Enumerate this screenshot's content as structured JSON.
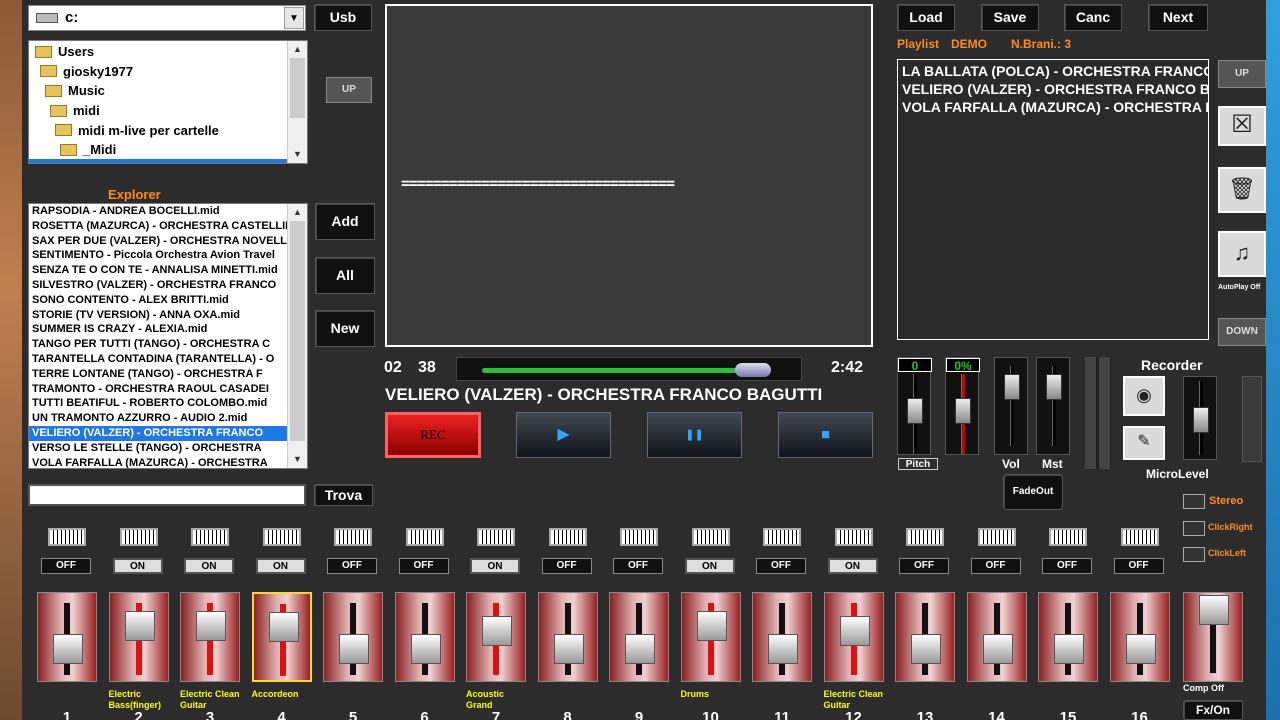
{
  "drive": {
    "label": "c:"
  },
  "buttons": {
    "usb": "Usb",
    "add": "Add",
    "all": "All",
    "new": "New",
    "find": "Trova",
    "up": "UP",
    "down": "DOWN"
  },
  "tree": [
    "Users",
    "giosky1977",
    "Music",
    "midi",
    "midi m-live per cartelle",
    "_Midi"
  ],
  "explorer_label": "Explorer",
  "files": [
    "RAPSODIA - ANDREA BOCELLI.mid",
    "ROSETTA (MAZURCA) - ORCHESTRA CASTELLINA",
    "SAX PER DUE (VALZER) - ORCHESTRA NOVELLO",
    "SENTIMENTO - Piccola Orchestra Avion Travel",
    "SENZA TE O CON TE - ANNALISA MINETTI.mid",
    "SILVESTRO (VALZER) - ORCHESTRA FRANCO",
    "SONO CONTENTO - ALEX BRITTI.mid",
    "STORIE (TV VERSION) - ANNA OXA.mid",
    "SUMMER IS CRAZY - ALEXIA.mid",
    "TANGO PER TUTTI (TANGO) - ORCHESTRA C",
    "TARANTELLA CONTADINA (TARANTELLA) - O",
    "TERRE LONTANE (TANGO) - ORCHESTRA F",
    "TRAMONTO - ORCHESTRA RAOUL CASADEI",
    "TUTTI BEATIFUL - ROBERTO COLOMBO.mid",
    "UN TRAMONTO AZZURRO - AUDIO 2.mid",
    "VELIERO (VALZER) - ORCHESTRA FRANCO",
    "VERSO LE STELLE (TANGO) - ORCHESTRA",
    "VOLA FARFALLA (MAZURCA) - ORCHESTRA"
  ],
  "selected_file_index": 15,
  "display": {
    "text": "=================================="
  },
  "player": {
    "minutes": "02",
    "seconds": "38",
    "total": "2:42",
    "progress": 0.97,
    "song": "VELIERO (VALZER) - ORCHESTRA FRANCO BAGUTTI",
    "rec": "REC",
    "play_icon": "▶",
    "pause_icon": "❚❚",
    "stop_icon": "■"
  },
  "top": {
    "load": "Load",
    "save": "Save",
    "canc": "Canc",
    "next": "Next"
  },
  "playlist": {
    "label": "Playlist",
    "name": "DEMO",
    "count_label": "N.Brani.: 3",
    "items": [
      "LA BALLATA (POLCA) - ORCHESTRA FRANCO",
      "VELIERO (VALZER) - ORCHESTRA FRANCO B",
      "VOLA FARFALLA (MAZURCA) - ORCHESTRA F"
    ]
  },
  "side": {
    "autoplay": "AutoPlay Off",
    "recorder": "Recorder",
    "microlevel": "MicroLevel",
    "fadeout": "FadeOut"
  },
  "meters": {
    "pitch_val": "0",
    "pitch_label": "Pitch",
    "pct_val": "0%",
    "vol": "Vol",
    "mst": "Mst"
  },
  "options": {
    "stereo": "Stereo",
    "clickright": "ClickRight",
    "clickleft": "ClickLeft"
  },
  "mixer": [
    {
      "num": "1",
      "state": "OFF",
      "name": "",
      "level": 0.35
    },
    {
      "num": "2",
      "state": "ON",
      "name": "Electric Bass(finger)",
      "level": 0.8
    },
    {
      "num": "3",
      "state": "ON",
      "name": "Electric Clean Guitar",
      "level": 0.8
    },
    {
      "num": "4",
      "state": "ON",
      "name": "Accordeon",
      "level": 0.8
    },
    {
      "num": "5",
      "state": "OFF",
      "name": "",
      "level": 0.35
    },
    {
      "num": "6",
      "state": "OFF",
      "name": "",
      "level": 0.35
    },
    {
      "num": "7",
      "state": "ON",
      "name": "Acoustic Grand",
      "level": 0.7
    },
    {
      "num": "8",
      "state": "OFF",
      "name": "",
      "level": 0.35
    },
    {
      "num": "9",
      "state": "OFF",
      "name": "",
      "level": 0.35
    },
    {
      "num": "10",
      "state": "ON",
      "name": "Drums",
      "level": 0.8
    },
    {
      "num": "11",
      "state": "OFF",
      "name": "",
      "level": 0.35
    },
    {
      "num": "12",
      "state": "ON",
      "name": "Electric Clean Guitar",
      "level": 0.7
    },
    {
      "num": "13",
      "state": "OFF",
      "name": "",
      "level": 0.35
    },
    {
      "num": "14",
      "state": "OFF",
      "name": "",
      "level": 0.35
    },
    {
      "num": "15",
      "state": "OFF",
      "name": "",
      "level": 0.35
    },
    {
      "num": "16",
      "state": "OFF",
      "name": "",
      "level": 0.35
    }
  ],
  "comp": {
    "label": "Comp Off",
    "fx": "Fx/On"
  }
}
